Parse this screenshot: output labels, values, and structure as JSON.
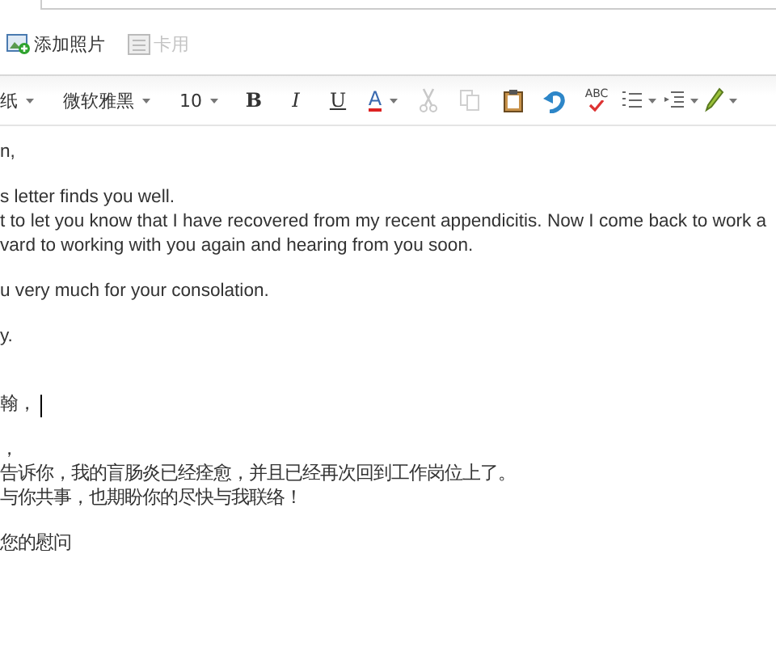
{
  "attach_bar": [
    {
      "label": "添加照片",
      "disabled": false
    },
    {
      "label": "卡用",
      "disabled": true
    }
  ],
  "format_toolbar": [
    {
      "kind": "dropdown",
      "label": "纸"
    },
    {
      "kind": "dropdown",
      "label": "微软雅黑"
    },
    {
      "kind": "dropdown",
      "label": "10"
    },
    {
      "kind": "bold",
      "label": "B"
    },
    {
      "kind": "italic",
      "label": "I"
    },
    {
      "kind": "underline",
      "label": "U"
    },
    {
      "kind": "color",
      "label": "A"
    },
    {
      "kind": "cut",
      "disabled": true
    },
    {
      "kind": "copy",
      "disabled": true
    },
    {
      "kind": "paste",
      "disabled": false
    },
    {
      "kind": "undo",
      "disabled": false
    },
    {
      "kind": "spell",
      "label": "ABC"
    },
    {
      "kind": "list"
    },
    {
      "kind": "indent"
    },
    {
      "kind": "highlight"
    }
  ],
  "body": [
    {
      "lines": [
        "n,"
      ],
      "caret": false
    },
    {
      "lines": [
        "s letter finds you well.",
        "t to let you know that I have recovered from my recent appendicitis. Now I come back to work a",
        "vard to working with you again and hearing from you soon."
      ],
      "caret": false
    },
    {
      "lines": [
        "u very much for your consolation."
      ],
      "caret": false
    },
    {
      "lines": [
        "y."
      ],
      "caret": false
    },
    {
      "lines": [
        "翰，"
      ],
      "caret": true
    },
    {
      "lines": [
        "，",
        "告诉你，我的盲肠炎已经痊愈，并且已经再次回到工作岗位上了。",
        "与你共事，也期盼你的尽快与我联络！"
      ],
      "caret": false
    },
    {
      "lines": [
        "您的慰问"
      ],
      "caret": false
    }
  ]
}
